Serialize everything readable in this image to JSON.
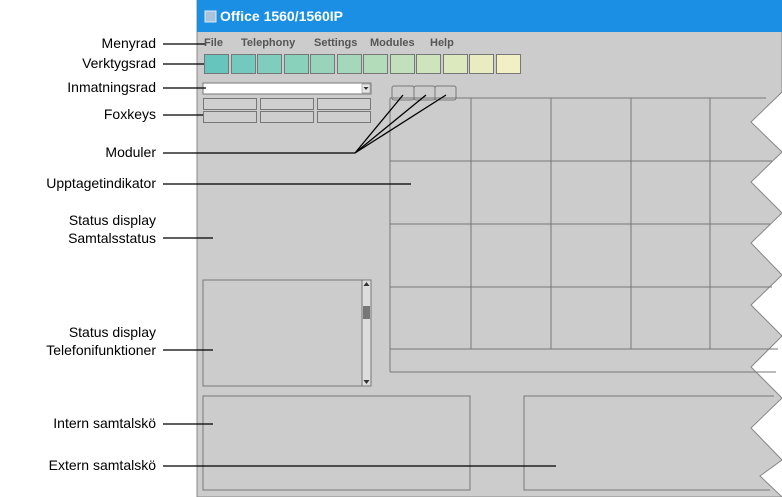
{
  "window": {
    "title": "Office 1560/1560IP"
  },
  "menu": [
    "File",
    "Telephony",
    "Settings",
    "Modules",
    "Help"
  ],
  "toolbar": {
    "button_colors": [
      "#66c6be",
      "#72c9bd",
      "#7ecdbd",
      "#8ad1bc",
      "#97d4bb",
      "#a5d8bb",
      "#b3dcba",
      "#c1e0bb",
      "#cfe4bc",
      "#dce9be",
      "#e9ecc1",
      "#f3efc4"
    ]
  },
  "colors": {
    "title_bar": "#1a8fe3",
    "window_bg": "#cccccc"
  },
  "labels": {
    "menyrad": "Menyrad",
    "verktygsrad": "Verktygsrad",
    "inmatningsrad": "Inmatningsrad",
    "foxkeys": "Foxkeys",
    "moduler": "Moduler",
    "upptagetindikator": "Upptagetindikator",
    "status_samtal_1": "Status display",
    "status_samtal_2": "Samtalsstatus",
    "status_tel_1": "Status display",
    "status_tel_2": "Telefonifunktioner",
    "intern": "Intern samtalskö",
    "extern": "Extern samtalskö"
  }
}
